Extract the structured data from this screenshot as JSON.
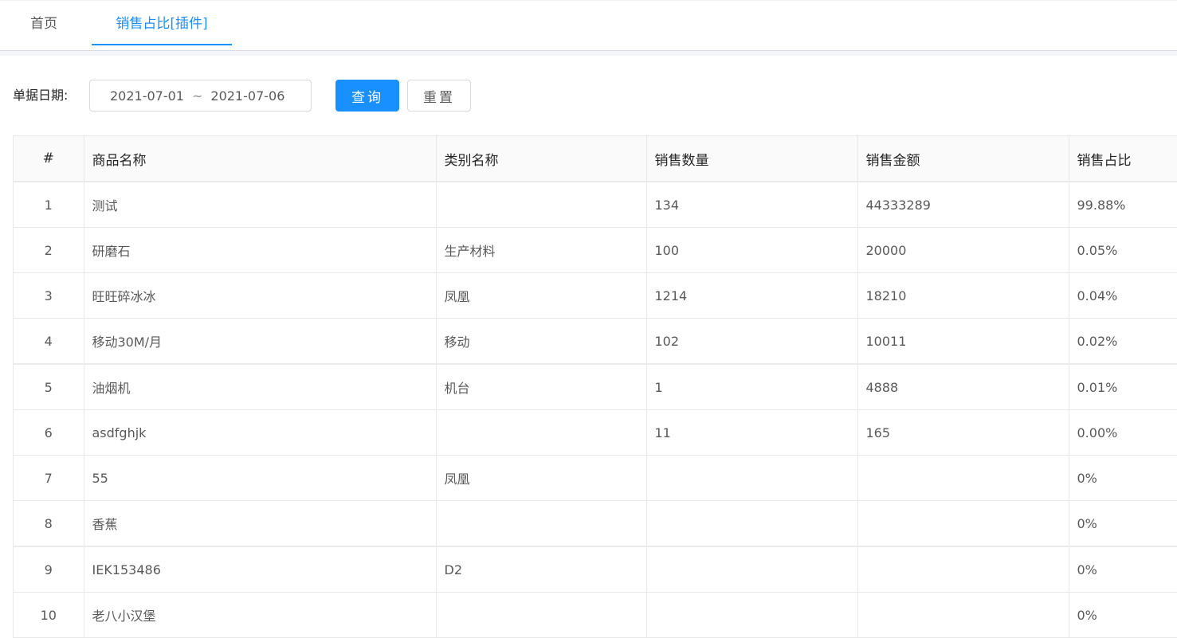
{
  "tabs": [
    {
      "label": "首页",
      "active": false
    },
    {
      "label": "销售占比[插件]",
      "active": true
    }
  ],
  "filter": {
    "label": "单据日期:",
    "date_start": "2021-07-01",
    "date_separator": "~",
    "date_end": "2021-07-06",
    "query_button": "查询",
    "reset_button": "重置"
  },
  "table": {
    "columns": [
      "#",
      "商品名称",
      "类别名称",
      "销售数量",
      "销售金额",
      "销售占比"
    ],
    "rows": [
      [
        "1",
        "测试",
        "",
        "134",
        "44333289",
        "99.88%"
      ],
      [
        "2",
        "研磨石",
        "生产材料",
        "100",
        "20000",
        "0.05%"
      ],
      [
        "3",
        "旺旺碎冰冰",
        "凤凰",
        "1214",
        "18210",
        "0.04%"
      ],
      [
        "4",
        "移动30M/月",
        "移动",
        "102",
        "10011",
        "0.02%"
      ],
      [
        "5",
        "油烟机",
        "机台",
        "1",
        "4888",
        "0.01%"
      ],
      [
        "6",
        "asdfghjk",
        "",
        "11",
        "165",
        "0.00%"
      ],
      [
        "7",
        "55",
        "凤凰",
        "",
        "",
        "0%"
      ],
      [
        "8",
        "香蕉",
        "",
        "",
        "",
        "0%"
      ],
      [
        "9",
        "IEK153486",
        "D2",
        "",
        "",
        "0%"
      ],
      [
        "10",
        "老八小汉堡",
        "",
        "",
        "",
        "0%"
      ]
    ]
  },
  "colors": {
    "primary": "#1890ff",
    "border": "#e8e8e8",
    "header_bg": "#fafafa"
  }
}
